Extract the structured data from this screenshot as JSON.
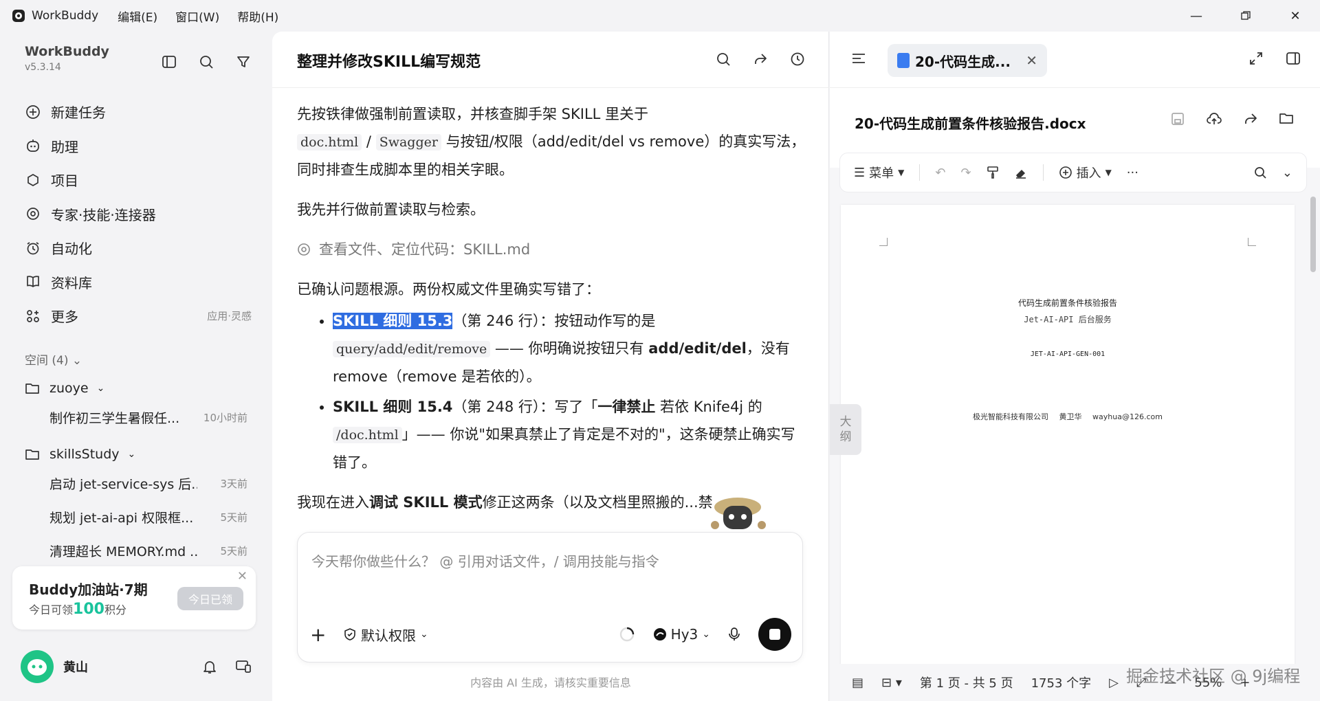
{
  "titlebar": {
    "app": "WorkBuddy",
    "menus": [
      "编辑(E)",
      "窗口(W)",
      "帮助(H)"
    ]
  },
  "sidebar": {
    "brand": "WorkBuddy",
    "version": "v5.3.14",
    "nav": [
      {
        "label": "新建任务",
        "icon": "plus-circle-icon"
      },
      {
        "label": "助理",
        "icon": "assistant-icon"
      },
      {
        "label": "项目",
        "icon": "project-icon"
      },
      {
        "label": "专家·技能·连接器",
        "icon": "expert-icon"
      },
      {
        "label": "自动化",
        "icon": "alarm-icon"
      },
      {
        "label": "资料库",
        "icon": "book-icon"
      },
      {
        "label": "更多",
        "icon": "grid-icon",
        "sub": "应用·灵感"
      }
    ],
    "spaces_header": "空间 (4)",
    "folders": [
      {
        "name": "zuoye",
        "tasks": [
          {
            "title": "制作初三学生暑假任...",
            "time": "10小时前"
          }
        ]
      },
      {
        "name": "skillsStudy",
        "tasks": [
          {
            "title": "启动 jet-service-sys 后...",
            "time": "3天前"
          },
          {
            "title": "规划 jet-ai-api 权限框...",
            "time": "5天前"
          },
          {
            "title": "清理超长 MEMORY.md ...",
            "time": "5天前"
          }
        ]
      }
    ],
    "promo": {
      "title": "Buddy加油站·7期",
      "sub_prefix": "今日可领",
      "points": "100",
      "sub_suffix": "积分",
      "button": "今日已领"
    },
    "user": {
      "name": "黄山"
    }
  },
  "chat": {
    "title": "整理并修改SKILL编写规范",
    "para1_a": "先按铁律做强制前置读取，并核查脚手架 SKILL 里关于",
    "para1_code1": "doc.html",
    "para1_slash": " / ",
    "para1_code2": "Swagger",
    "para1_b": " 与按钮/权限（add/edit/del vs remove）的真实写法，同时排查生成脚本里的相关字眼。",
    "para2": "我先并行做前置读取与检索。",
    "tool_line": "查看文件、定位代码：SKILL.md",
    "para3": "已确认问题根源。两份权威文件里确实写错了：",
    "b1_hl": "SKILL 细则 15.3",
    "b1_a": "（第 246 行）：按钮动作写的是",
    "b1_code": "query/add/edit/remove",
    "b1_b": " —— 你明确说按钮只有 ",
    "b1_bold": "add/edit/del",
    "b1_c": "，没有 remove（remove 是若依的）。",
    "b2_bold": "SKILL 细则 15.4",
    "b2_a": "（第 248 行）：写了「",
    "b2_bold2": "一律禁止",
    "b2_b": " 若依 Knife4j 的",
    "b2_code": "/doc.html",
    "b2_c": "」—— 你说\"如果真禁止了肯定是不对的\"，这条硬禁止确实写错了。",
    "para4_a": "我现在进入",
    "para4_bold": "调试 SKILL 模式",
    "para4_b": "修正这两条（以及文档里照搬的...禁",
    "input_placeholder": "今天帮你做些什么？ @ 引用对话文件，/ 调用技能与指令",
    "permission": "默认权限",
    "model": "Hy3",
    "disclaimer": "内容由 AI 生成，请核实重要信息"
  },
  "doc": {
    "tab_title": "20-代码生成...",
    "file_title": "20-代码生成前置条件核验报告.docx",
    "toolbar": {
      "menu": "菜单",
      "insert": "插入"
    },
    "page": {
      "title": "代码生成前置条件核验报告",
      "subtitle": "Jet-AI-API 后台服务",
      "code": "JET-AI-API-GEN-001",
      "footer": "极光智能科技有限公司   黄卫华   wayhua@126.com"
    },
    "outline": [
      "大",
      "纲"
    ],
    "status": {
      "pages": "第 1 页 - 共 5 页",
      "words": "1753 个字",
      "zoom": "55%"
    }
  },
  "watermark": "掘金技术社区 @ 9j编程"
}
